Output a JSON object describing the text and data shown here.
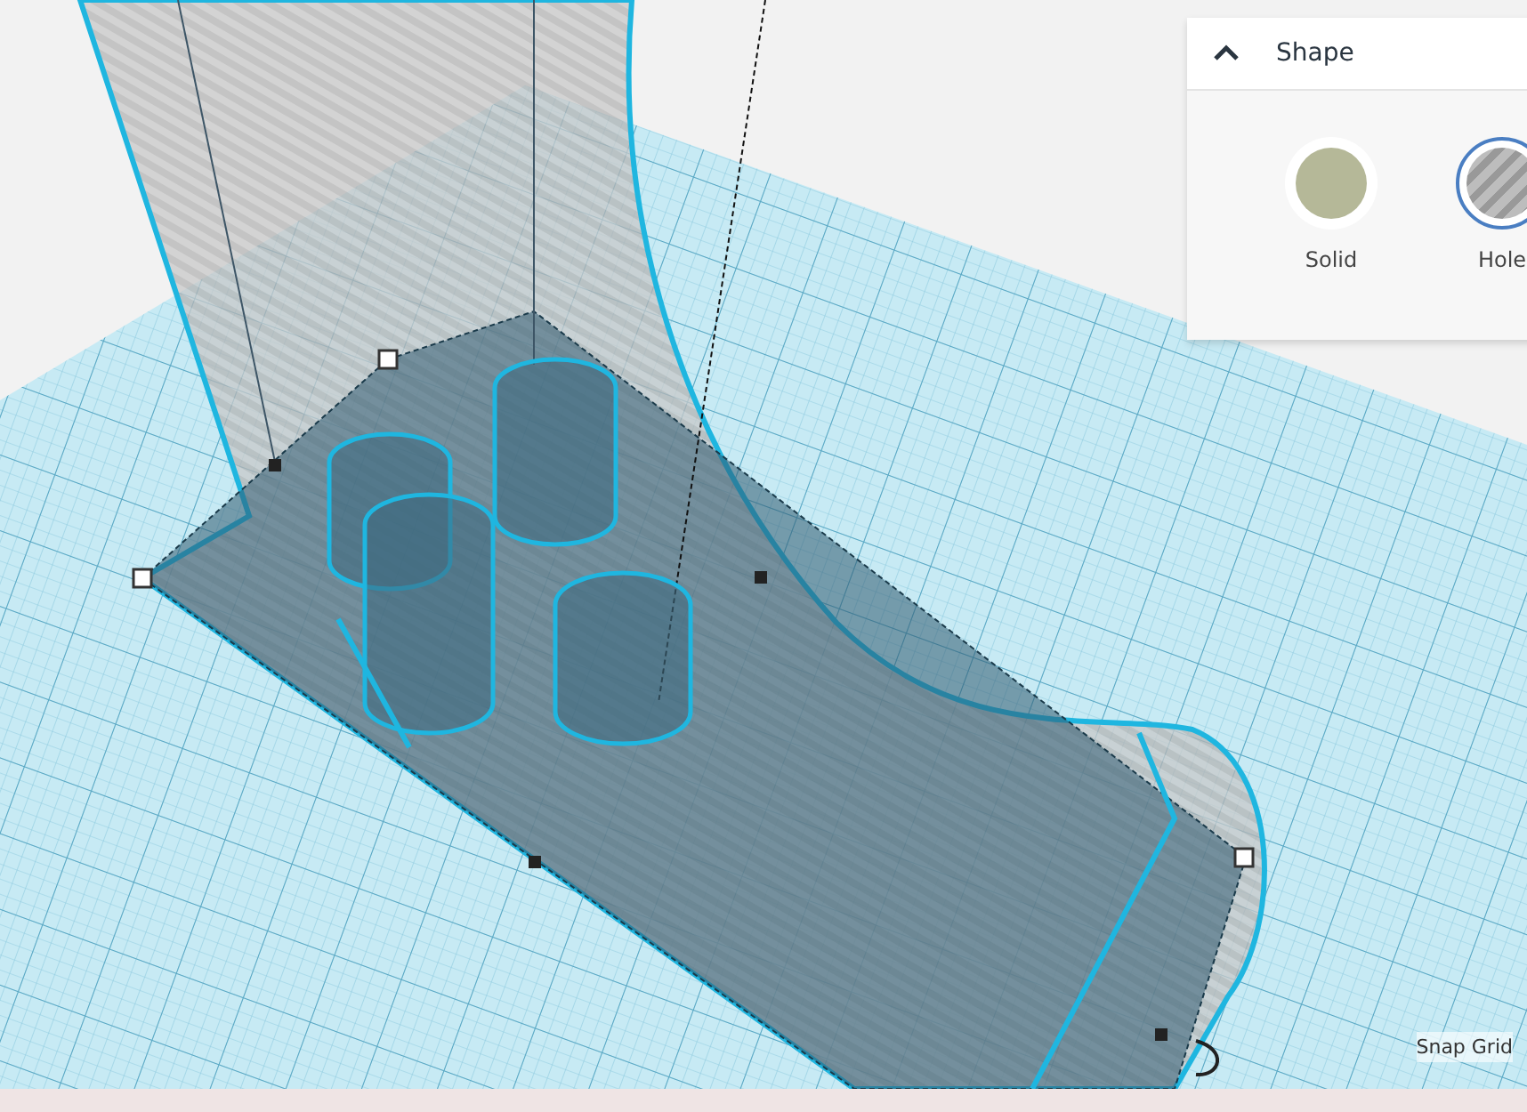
{
  "shape_panel": {
    "title": "Shape",
    "expanded": true,
    "options": [
      {
        "label": "Solid",
        "kind": "solid",
        "selected": false
      },
      {
        "label": "Hole",
        "kind": "hole",
        "selected": true
      }
    ]
  },
  "snap_grid": {
    "label": "Snap Grid"
  }
}
